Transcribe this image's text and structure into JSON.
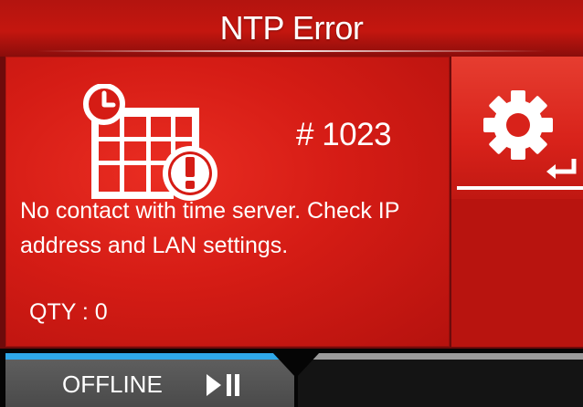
{
  "title": "NTP Error",
  "error": {
    "code": "# 1023",
    "message": "No contact with time server. Check IP address and LAN settings.",
    "qty": "QTY : 0",
    "icon": "calendar-clock-alert-icon"
  },
  "side": {
    "settings_icon": "gear-icon",
    "enter_icon": "enter-icon"
  },
  "status": {
    "label": "OFFLINE",
    "icon": "play-pause-icon",
    "progress": 0.49
  },
  "colors": {
    "accent_red": "#d51c15",
    "progress_blue": "#2fa8e8",
    "status_button": "#4a4a4a"
  }
}
